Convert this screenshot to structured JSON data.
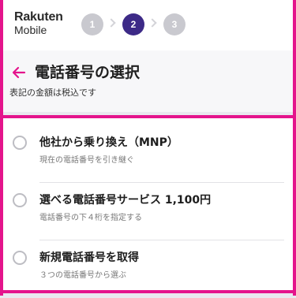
{
  "header": {
    "logo_top": "Rakuten",
    "logo_bottom": "Mobile",
    "steps": [
      "1",
      "2",
      "3"
    ],
    "active_step": "2"
  },
  "title_section": {
    "title": "電話番号の選択",
    "tax_note": "表記の金額は税込です"
  },
  "options": [
    {
      "title": "他社から乗り換え（MNP）",
      "description": "現在の電話番号を引き継ぐ"
    },
    {
      "title": "選べる電話番号サービス 1,100円",
      "description": "電話番号の下４桁を指定する"
    },
    {
      "title": "新規電話番号を取得",
      "description": "３つの電話番号から選ぶ"
    }
  ],
  "colors": {
    "highlight": "#e4148c",
    "active_step": "#3d2a87",
    "inactive_step": "#c9c9cf"
  }
}
